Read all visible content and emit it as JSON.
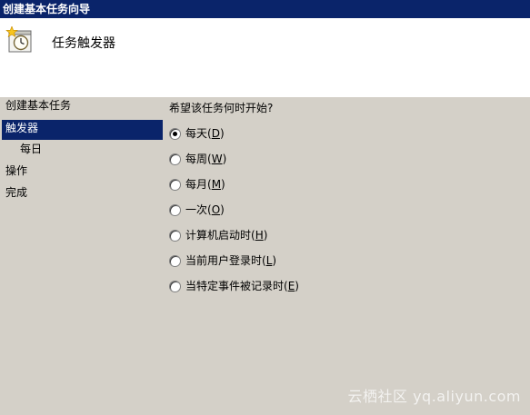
{
  "window": {
    "title": "创建基本任务向导"
  },
  "header": {
    "icon": "task-clock-icon",
    "title": "任务触发器"
  },
  "steps": [
    {
      "label": "创建基本任务",
      "selected": false,
      "indent": false
    },
    {
      "label": "触发器",
      "selected": true,
      "indent": false
    },
    {
      "label": "每日",
      "selected": false,
      "indent": true
    },
    {
      "label": "操作",
      "selected": false,
      "indent": false
    },
    {
      "label": "完成",
      "selected": false,
      "indent": false
    }
  ],
  "main": {
    "question": "希望该任务何时开始?",
    "options": [
      {
        "label": "每天(",
        "key": "D",
        "suffix": ")",
        "checked": true
      },
      {
        "label": "每周(",
        "key": "W",
        "suffix": ")",
        "checked": false
      },
      {
        "label": "每月(",
        "key": "M",
        "suffix": ")",
        "checked": false
      },
      {
        "label": "一次(",
        "key": "O",
        "suffix": ")",
        "checked": false
      },
      {
        "label": "计算机启动时(",
        "key": "H",
        "suffix": ")",
        "checked": false
      },
      {
        "label": "当前用户登录时(",
        "key": "L",
        "suffix": ")",
        "checked": false
      },
      {
        "label": "当特定事件被记录时(",
        "key": "E",
        "suffix": ")",
        "checked": false
      }
    ]
  },
  "watermark": "云栖社区 yq.aliyun.com",
  "colors": {
    "titlebar": "#0a246a",
    "dialog_bg": "#d4d0c8",
    "header_bg": "#ffffff",
    "selection": "#0a246a"
  }
}
